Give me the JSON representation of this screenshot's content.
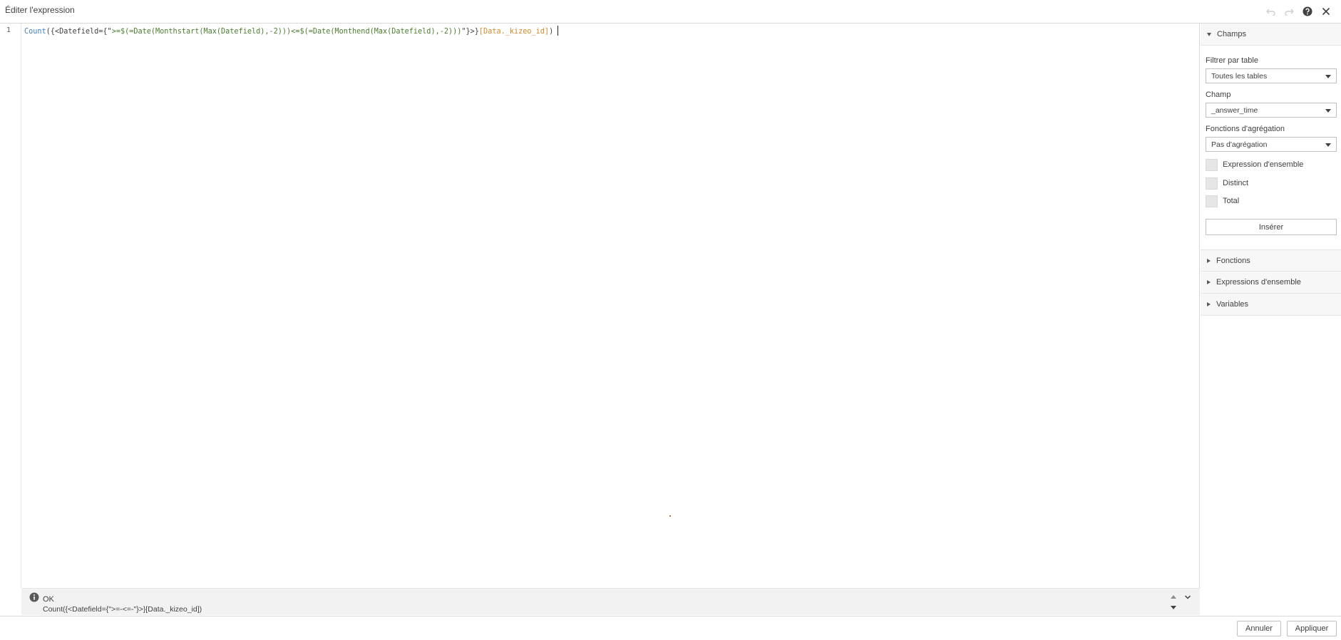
{
  "dialog": {
    "title": "Éditer l'expression"
  },
  "editor": {
    "line_number": "1",
    "tokens": {
      "fn": "Count",
      "open": "({<Datefield={\"",
      "str1": ">=$(=Date(Monthstart(Max(Datefield),-2)))",
      "str2": "<=$(=Date(Monthend(Max(Datefield),-2)))",
      "close": "\"}>}",
      "field": "[Data._kizeo_id]",
      "end": ")"
    }
  },
  "status": {
    "state": "OK",
    "expression": "Count({<Datefield={\">=-<=-\"}>}[Data._kizeo_id])"
  },
  "sidebar": {
    "fields_section": "Champs",
    "filter_label": "Filtrer par table",
    "filter_value": "Toutes les tables",
    "field_label": "Champ",
    "field_value": "_answer_time",
    "aggregation_label": "Fonctions d'agrégation",
    "aggregation_value": "Pas d'agrégation",
    "checkboxes": [
      {
        "label": "Expression d'ensemble",
        "checked": false
      },
      {
        "label": "Distinct",
        "checked": false
      },
      {
        "label": "Total",
        "checked": false
      }
    ],
    "insert_label": "Insérer",
    "sections": [
      "Fonctions",
      "Expressions d'ensemble",
      "Variables"
    ]
  },
  "footer": {
    "cancel_label": "Annuler",
    "apply_label": "Appliquer"
  },
  "icons": {
    "undo": "undo-icon",
    "redo": "redo-icon",
    "help": "help-icon",
    "close": "close-icon",
    "info": "info-icon"
  }
}
